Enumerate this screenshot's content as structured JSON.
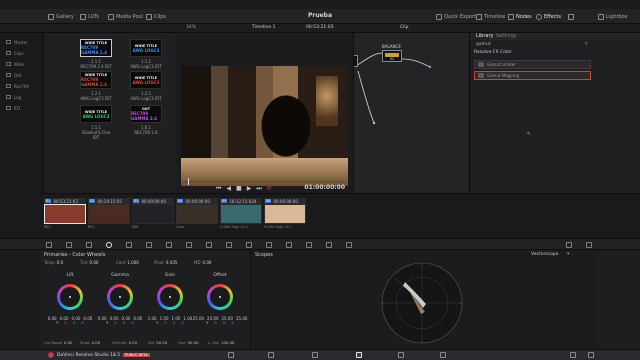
{
  "app_title": "Prueba",
  "topbar": {
    "gallery": "Gallery",
    "luts": "LUTs",
    "media_pool": "Media Pool",
    "clips": "Clips",
    "quick_export": "Quick Export",
    "timeline": "Timeline",
    "nodes": "Nodes",
    "effects": "Effects",
    "lightbox": "Lightbox"
  },
  "subbar": {
    "zoom": "34%",
    "timeline_name": "Timeline 1",
    "timecode": "00:53:21:03",
    "mode": "Clip"
  },
  "media_clips": [
    {
      "t1": "WIDE TITLE",
      "t2": "REC709 GAMMA 2.4",
      "color": "#3b8cff",
      "name": "1.1.1\nREC709 2.4 IDT",
      "selected": true
    },
    {
      "t1": "WIDE TITLE",
      "t2": "AWG LOGC3",
      "color": "#3b8cff",
      "name": "1.1.1\nAWG LogC3 IDT",
      "selected": false
    },
    {
      "t1": "WIDE TITLE",
      "t2": "REC709 GAMMA 2.4",
      "color": "#e0403a",
      "name": "1.2.1\nAWG LogC3 IDT",
      "selected": false
    },
    {
      "t1": "WIDE TITLE",
      "t2": "AWG LOGC3",
      "color": "#e0403a",
      "name": "1.2.1\nAWG LogC3 IDT",
      "selected": false
    },
    {
      "t1": "WIDE TITLE",
      "t2": "AWG LOGC3",
      "color": "#3cc060",
      "name": "1.5.1\nSGamut3.Cine IDT",
      "selected": false
    },
    {
      "t1": "ODT",
      "t2": "REC709 GAMMA 2.4",
      "color": "#c050e0",
      "name": "1.6.1\nREC709 2.4",
      "selected": false
    }
  ],
  "left_strip": [
    "Master",
    "Clips",
    "Wide",
    "Odt",
    "Rec709",
    "Log",
    "IDT"
  ],
  "viewer": {
    "timecode": "01:00:00:00"
  },
  "nodes": {
    "balance_label": "BALANCE",
    "node_id": "02"
  },
  "library": {
    "tab_library": "Library",
    "tab_settings": "Settings",
    "search": "gamut",
    "section": "Resolve FX Color",
    "items": [
      "Gamut Limiter",
      "Gamut Mapping"
    ]
  },
  "timeline_clips": [
    {
      "num": "01",
      "tc": "00:53:21:03",
      "foot": "REC",
      "bg": "#8a3a2a"
    },
    {
      "num": "02",
      "tc": "00:29:15:05",
      "foot": "REC",
      "bg": "#4a2a22"
    },
    {
      "num": "03",
      "tc": "00:00:00:00",
      "foot": "SIM",
      "bg": "#222226"
    },
    {
      "num": "04",
      "tc": "00:00:00:00",
      "foot": "Cam",
      "bg": "#3a3028"
    },
    {
      "num": "05",
      "tc": "16:12:15:024",
      "foot": "H.264 High L5.1",
      "bg": "#3a6a70"
    },
    {
      "num": "06",
      "tc": "00:00:00:00",
      "foot": "H.264 High L5.1",
      "bg": "#d8b896"
    }
  ],
  "primaries": {
    "title": "Primaries - Color Wheels",
    "params": {
      "temp": "0.0",
      "tint": "0.00",
      "cont": "1.000",
      "pivot": "0.435",
      "md": "0.00"
    },
    "wheels": [
      {
        "name": "Lift",
        "vals": [
          "0.00",
          "0.00",
          "0.00",
          "0.00"
        ]
      },
      {
        "name": "Gamma",
        "vals": [
          "0.00",
          "0.00",
          "0.00",
          "0.00"
        ]
      },
      {
        "name": "Gain",
        "vals": [
          "1.00",
          "1.00",
          "1.00",
          "1.00"
        ]
      },
      {
        "name": "Offset",
        "vals": [
          "25.00",
          "25.00",
          "25.00",
          "25.00"
        ]
      }
    ],
    "bottom": {
      "col_boost": "0.00",
      "shad": "0.00",
      "hi_light": "0.00",
      "sat": "50.00",
      "hue": "50.00",
      "l_mix": "100.00"
    }
  },
  "scopes": {
    "title": "Scopes",
    "mode": "Vectorscope"
  },
  "bottombar": {
    "brand": "DaVinci Resolve Studio 18.5",
    "badge": "PUBLIC BETA"
  }
}
